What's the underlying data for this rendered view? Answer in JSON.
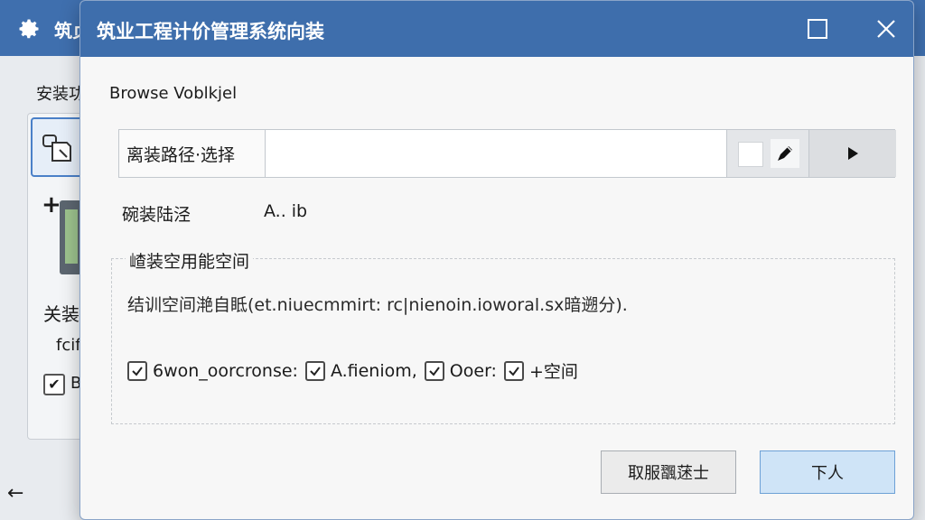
{
  "background_window": {
    "title": "筑贞",
    "subheading": "安装功",
    "side_label_1": "关装",
    "side_label_2": "fcif",
    "checkbox_label": "B"
  },
  "dialog": {
    "title": "筑业工程计价管理系统向装",
    "browse_label": "Browse Voblkjel",
    "path_label": "离装路径·选择",
    "path_value": "",
    "install_path_label": "碗装陆泾",
    "install_path_value": "A..  ib",
    "space_group_title": "嵖装空用能空间",
    "space_description": "结训空间滟自眡(et.niuecmmirt: rc|nienoin.ioworal.sx暗遡分).",
    "options": [
      {
        "label": "6won_oorcronse:",
        "checked": true
      },
      {
        "label": "A.fieniom,",
        "checked": true
      },
      {
        "label": "Ooer:",
        "checked": true
      },
      {
        "label": "+空间",
        "checked": true
      }
    ],
    "cancel_label": "取服飁蒁士",
    "next_label": "下人"
  },
  "colors": {
    "titlebar": "#3e6eac",
    "next_button": "#cfe4f7",
    "dialog_bg": "#f7f7f7"
  },
  "icons": [
    "gear-icon",
    "maximize-icon",
    "close-icon",
    "edit-icon",
    "play-icon",
    "back-arrow-icon",
    "check-icon"
  ]
}
